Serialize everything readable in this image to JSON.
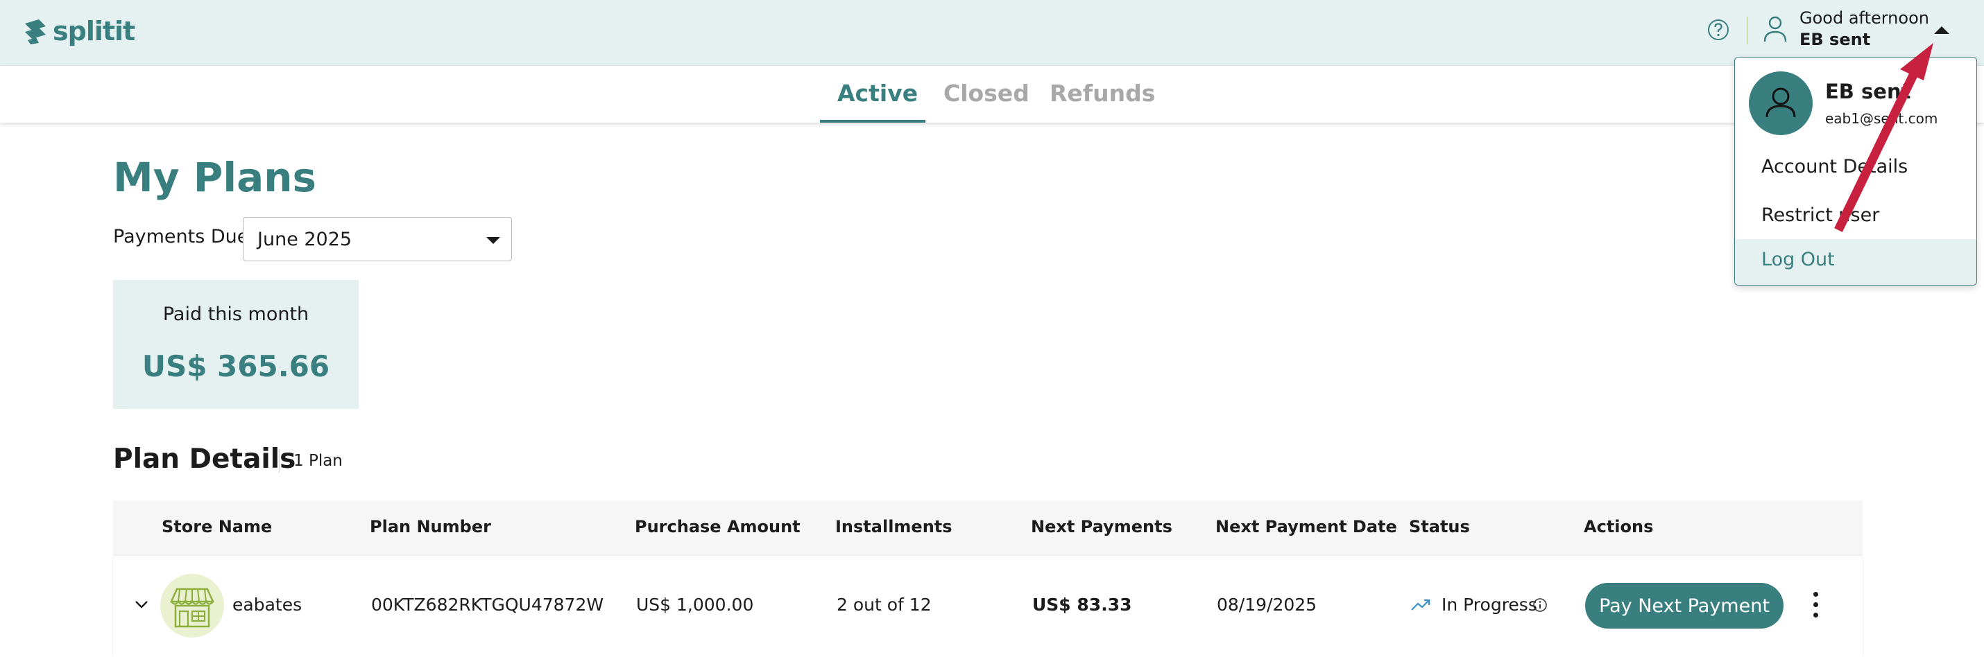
{
  "app": {
    "logo_text": "splitit"
  },
  "header": {
    "greeting": "Good afternoon",
    "user_name": "EB sent"
  },
  "tabs": [
    {
      "label": "Active",
      "active": true
    },
    {
      "label": "Closed",
      "active": false
    },
    {
      "label": "Refunds",
      "active": false
    }
  ],
  "page": {
    "title": "My Plans",
    "payments_due_label": "Payments Due",
    "payments_due_value": "June 2025"
  },
  "summary": {
    "paid_label": "Paid this month",
    "paid_value": "US$ 365.66"
  },
  "plans": {
    "title": "Plan Details",
    "count": "1 Plan",
    "columns": [
      "Store Name",
      "Plan Number",
      "Purchase Amount",
      "Installments",
      "Next Payments",
      "Next Payment Date",
      "Status",
      "Actions"
    ],
    "rows": [
      {
        "store_name": "eabates",
        "plan_number": "00KTZ682RKTGQU47872W",
        "purchase_amount": "US$ 1,000.00",
        "installments": "2 out of 12",
        "next_payment": "US$ 83.33",
        "next_payment_date": "08/19/2025",
        "status": "In Progress",
        "action_label": "Pay Next Payment"
      }
    ]
  },
  "user_menu": {
    "name": "EB sent",
    "email": "eab1@sent.com",
    "items": [
      "Account Details",
      "Restrict user",
      "Log Out"
    ]
  },
  "colors": {
    "brand": "#3a7f80",
    "header_bg": "#e5f1f1",
    "annotation_arrow": "#c8203f"
  },
  "icons": [
    "splitit-logo-icon",
    "help-icon",
    "user-icon",
    "caret-up-icon",
    "chevron-down-icon",
    "store-icon",
    "trend-up-icon",
    "info-icon",
    "kebab-menu-icon",
    "avatar-icon"
  ]
}
